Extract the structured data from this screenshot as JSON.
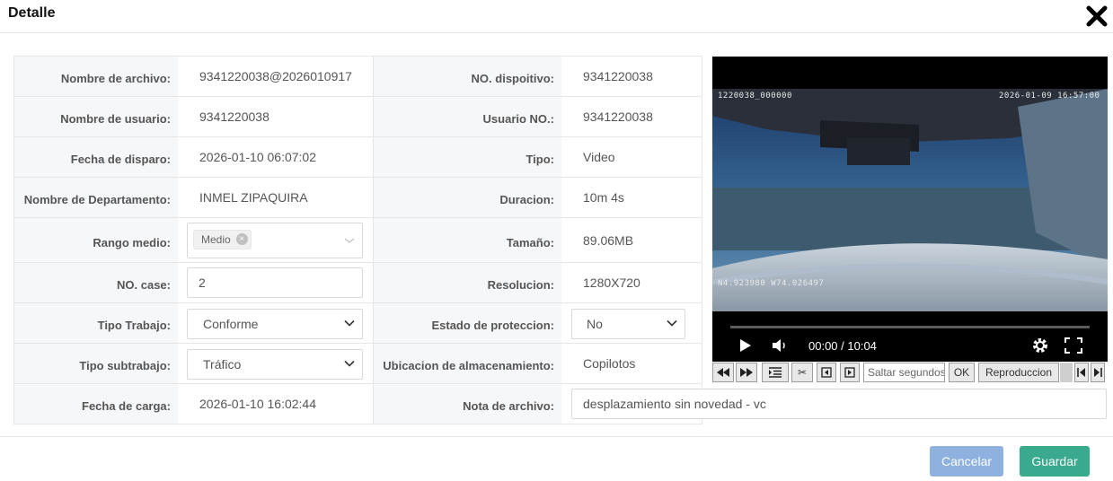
{
  "dialog": {
    "title": "Detalle"
  },
  "left": {
    "nombre_archivo": {
      "label": "Nombre de archivo:",
      "value": "9341220038@2026010917"
    },
    "nombre_usuario": {
      "label": "Nombre de usuario:",
      "value": "9341220038"
    },
    "fecha_disparo": {
      "label": "Fecha de disparo:",
      "value": "2026-01-10 06:07:02"
    },
    "departamento": {
      "label": "Nombre de Departamento:",
      "value": "INMEL ZIPAQUIRA"
    },
    "rango_medio": {
      "label": "Rango medio:",
      "tag": "Medio"
    },
    "no_case": {
      "label": "NO. case:",
      "value": "2"
    },
    "tipo_trabajo": {
      "label": "Tipo Trabajo:",
      "value": "Conforme"
    },
    "tipo_subtrabajo": {
      "label": "Tipo subtrabajo:",
      "value": "Tráfico"
    },
    "fecha_carga": {
      "label": "Fecha de carga:",
      "value": "2026-01-10 16:02:44"
    }
  },
  "right": {
    "no_dispositivo": {
      "label": "NO. dispoitivo:",
      "value": "9341220038"
    },
    "usuario_no": {
      "label": "Usuario NO.:",
      "value": "9341220038"
    },
    "tipo": {
      "label": "Tipo:",
      "value": "Video"
    },
    "duracion": {
      "label": "Duracion:",
      "value": "10m 4s"
    },
    "tamano": {
      "label": "Tamaño:",
      "value": "89.06MB"
    },
    "resolucion": {
      "label": "Resolucion:",
      "value": "1280X720"
    },
    "estado_proteccion": {
      "label": "Estado de proteccion:",
      "value": "No"
    },
    "ubicacion": {
      "label": "Ubicacion de almacenamiento:",
      "value": "Copilotos"
    },
    "nota": {
      "label": "Nota de archivo:",
      "value": "desplazamiento sin novedad - vc"
    }
  },
  "video": {
    "osd_top_left": "1220038_000000",
    "osd_top_right": "2026-01-09 16:57:00",
    "osd_coords": "N4.923980 W74.026497",
    "time": "00:00 / 10:04",
    "progress": 0.0
  },
  "player_controls": {
    "seek_placeholder": "Saltar segundos",
    "ok": "OK",
    "playback": "Reproduccion"
  },
  "footer": {
    "cancel": "Cancelar",
    "save": "Guardar"
  },
  "colors": {
    "cancel_bg": "#8eb1e0",
    "save_bg": "#3aaa8e"
  }
}
